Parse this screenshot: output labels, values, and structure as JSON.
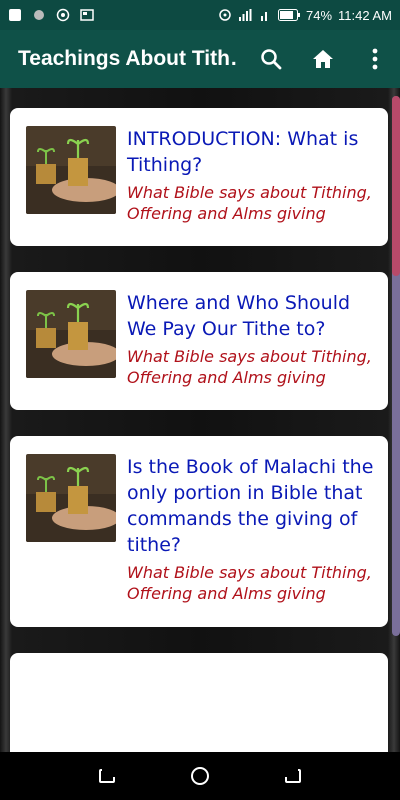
{
  "status_bar": {
    "battery": "74%",
    "time": "11:42 AM"
  },
  "app_bar": {
    "title": "Teachings About Tith…",
    "icons": [
      "search-icon",
      "home-icon",
      "overflow-menu-icon"
    ]
  },
  "list": {
    "items": [
      {
        "title": "INTRODUCTION: What is Tithing?",
        "subtitle": "What Bible says about Tithing, Offering and Alms giving"
      },
      {
        "title": "Where and Who Should We Pay Our Tithe to?",
        "subtitle": "What Bible says about Tithing, Offering and Alms giving"
      },
      {
        "title": "Is the Book of Malachi the only portion in Bible that commands the giving of tithe?",
        "subtitle": "What Bible says about Tithing, Offering and Alms giving"
      }
    ]
  },
  "colors": {
    "app_bar": "#0f5148",
    "title_text": "#0a19b6",
    "subtitle_text": "#b0111a"
  },
  "nav_bar": {
    "icons": [
      "recents-icon",
      "home-circle-icon",
      "back-icon"
    ]
  }
}
